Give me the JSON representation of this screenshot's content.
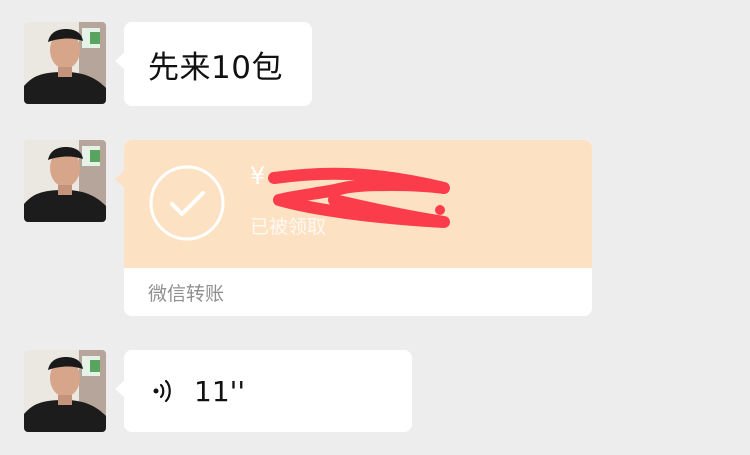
{
  "messages": [
    {
      "type": "text",
      "text": "先来10包"
    },
    {
      "type": "transfer",
      "currency_symbol": "¥",
      "status": "已被领取",
      "footer": "微信转账",
      "colors": {
        "card_top": "#fde1c3",
        "redaction": "#fb3d4b"
      }
    },
    {
      "type": "voice",
      "duration": "11''"
    }
  ],
  "icons": {
    "avatar": "avatar",
    "check": "check-circle-icon",
    "voice": "voice-icon"
  }
}
